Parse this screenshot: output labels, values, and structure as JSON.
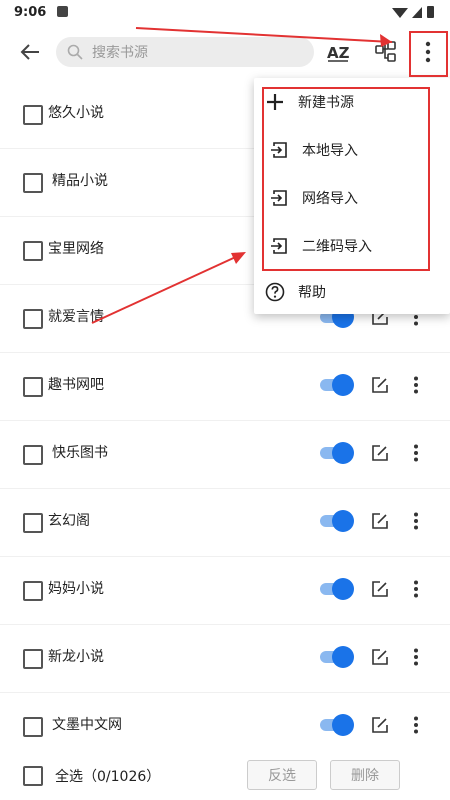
{
  "status": {
    "time": "9:06"
  },
  "toolbar": {
    "search_placeholder": "搜索书源",
    "sort_label": "AZ"
  },
  "sources": [
    {
      "name": "悠久小说"
    },
    {
      "name": "精品小说"
    },
    {
      "name": "宝里网络"
    },
    {
      "name": "就爱言情"
    },
    {
      "name": "趣书网吧"
    },
    {
      "name": "快乐图书"
    },
    {
      "name": "玄幻阁"
    },
    {
      "name": "妈妈小说"
    },
    {
      "name": "新龙小说"
    },
    {
      "name": "文墨中文网"
    }
  ],
  "menu": {
    "items": [
      {
        "label": "新建书源",
        "icon": "plus-icon"
      },
      {
        "label": "本地导入",
        "icon": "import-icon"
      },
      {
        "label": "网络导入",
        "icon": "import-icon"
      },
      {
        "label": "二维码导入",
        "icon": "import-icon"
      },
      {
        "label": "帮助",
        "icon": "help-icon"
      }
    ]
  },
  "bottom": {
    "select_all": "全选（0/1026）",
    "invert": "反选",
    "delete": "删除"
  },
  "colors": {
    "accent": "#1a73e8",
    "annotation": "#e23232"
  }
}
